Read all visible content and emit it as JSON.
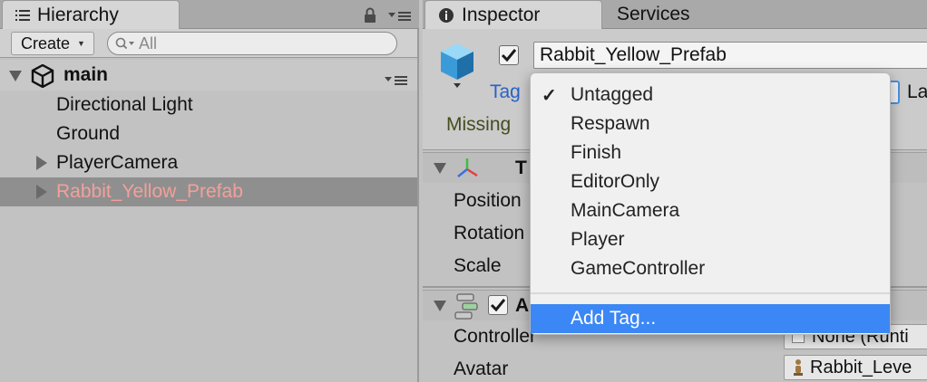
{
  "hierarchy": {
    "tab_label": "Hierarchy",
    "create_label": "Create",
    "search_placeholder": "All",
    "scene_name": "main",
    "items": [
      {
        "label": "Directional Light"
      },
      {
        "label": "Ground"
      },
      {
        "label": "PlayerCamera"
      },
      {
        "label": "Rabbit_Yellow_Prefab"
      }
    ]
  },
  "inspector": {
    "tab_label": "Inspector",
    "services_tab_label": "Services",
    "object_name": "Rabbit_Yellow_Prefab",
    "tag_label": "Tag",
    "layer_label_partial": "La",
    "missing_label": "Missing",
    "transform_partial": "T",
    "animator_partial": "A",
    "properties": {
      "position": "Position",
      "rotation": "Rotation",
      "scale": "Scale",
      "controller": "Controller",
      "avatar": "Avatar"
    },
    "controller_value": "None (Runti",
    "avatar_value": "Rabbit_Leve"
  },
  "tag_menu": {
    "items": [
      {
        "label": "Untagged",
        "checked": true
      },
      {
        "label": "Respawn"
      },
      {
        "label": "Finish"
      },
      {
        "label": "EditorOnly"
      },
      {
        "label": "MainCamera"
      },
      {
        "label": "Player"
      },
      {
        "label": "GameController"
      }
    ],
    "add_tag": "Add Tag...",
    "check_mark": "✓"
  },
  "colors": {
    "selection_text": "#f3a09b",
    "menu_highlight": "#3b87f5",
    "tag_label": "#2862c7"
  }
}
